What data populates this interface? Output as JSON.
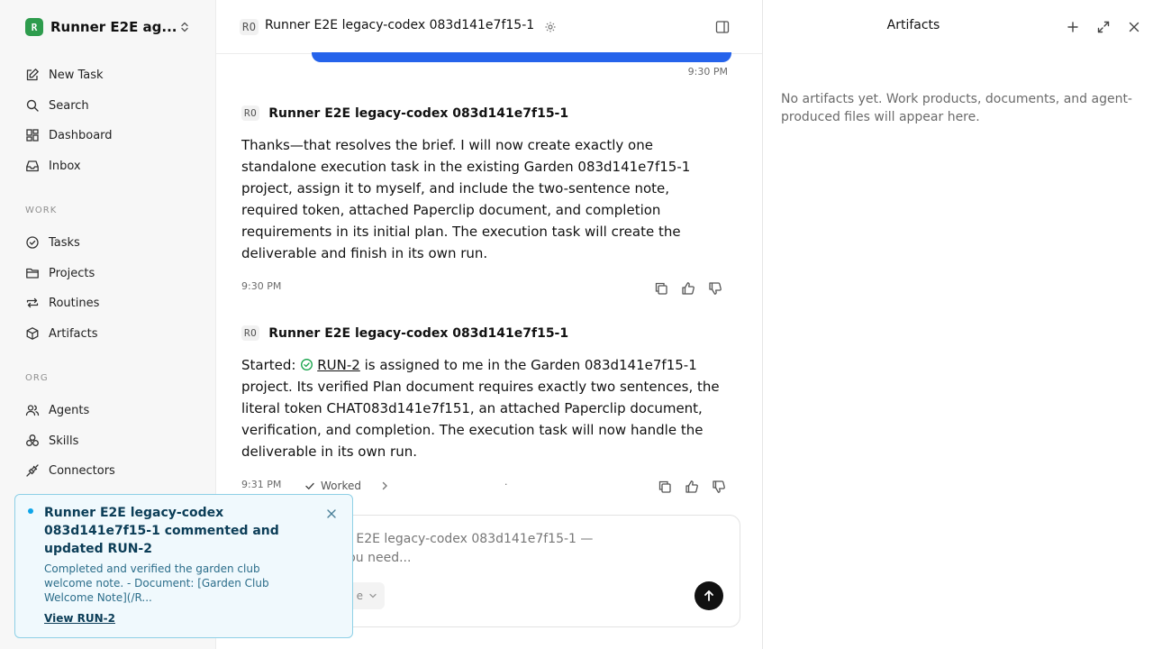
{
  "sidebar": {
    "workspace_name": "Runner E2E ag...",
    "workspace_initial": "R",
    "nav_top": [
      {
        "label": "New Task",
        "icon": "edit-icon"
      },
      {
        "label": "Search",
        "icon": "search-icon"
      },
      {
        "label": "Dashboard",
        "icon": "dashboard-icon"
      },
      {
        "label": "Inbox",
        "icon": "inbox-icon"
      }
    ],
    "section_work": "WORK",
    "nav_work": [
      {
        "label": "Tasks",
        "icon": "check-circle-icon"
      },
      {
        "label": "Projects",
        "icon": "folder-icon"
      },
      {
        "label": "Routines",
        "icon": "repeat-icon"
      },
      {
        "label": "Artifacts",
        "icon": "package-icon"
      }
    ],
    "section_org": "ORG",
    "nav_org": [
      {
        "label": "Agents",
        "icon": "users-icon"
      },
      {
        "label": "Skills",
        "icon": "skills-icon"
      },
      {
        "label": "Connectors",
        "icon": "plug-icon"
      }
    ]
  },
  "toast": {
    "title": "Runner E2E legacy-codex 083d141e7f15-1 commented and updated RUN-2",
    "body": "Completed and verified the garden club welcome note. - Document: [Garden Club Welcome Note](/R...",
    "link": "View RUN-2"
  },
  "chat": {
    "header_initials": "RO",
    "header_title": "Runner E2E legacy-codex 083d141e7f15-1",
    "user_message_time": "9:30 PM",
    "messages": [
      {
        "initials": "RO",
        "author": "Runner E2E legacy-codex 083d141e7f15-1",
        "text": "Thanks—that resolves the brief. I will now create exactly one standalone execution task in the existing Garden 083d141e7f15-1 project, assign it to myself, and include the two-sentence note, required token, attached Paperclip document, and completion requirements in its initial plan. The execution task will create the deliverable and finish in its own run.",
        "time": "9:30 PM"
      },
      {
        "initials": "RO",
        "author": "Runner E2E legacy-codex 083d141e7f15-1",
        "text_before": "Started: ",
        "link": "RUN-2",
        "text_after": " is assigned to me in the Garden 083d141e7f15-1 project. Its verified Plan document requires exactly two sentences, the literal token CHAT083d141e7f151, an attached Paperclip document, verification, and completion. The execution task will now handle the deliverable in its own run.",
        "time": "9:31 PM",
        "separator": "·",
        "worked_label": "Worked"
      }
    ],
    "composer_placeholder": "Message Runner E2E legacy-codex 083d141e7f15-1 — describe what you need...",
    "mode_label": "e"
  },
  "artifacts": {
    "title": "Artifacts",
    "empty_text": "No artifacts yet. Work products, documents, and agent-produced files will appear here."
  },
  "colors": {
    "accent": "#2563eb",
    "toast_bg": "#f0f9fd",
    "toast_border": "#8ed0e6",
    "workspace_logo": "#2e9c4d"
  }
}
